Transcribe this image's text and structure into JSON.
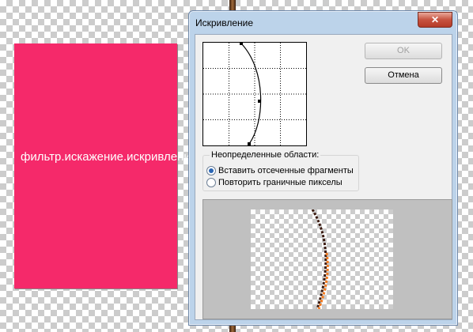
{
  "canvas": {
    "text": "фильтр.искажение.искривление.",
    "color": "#f5296a"
  },
  "dialog": {
    "title": "Искривление",
    "close_label": "✕",
    "ok_label": "OK",
    "cancel_label": "Отмена",
    "undefined_areas": {
      "title": "Неопределенные области:",
      "options": [
        {
          "label": "Вставить отсеченные фрагменты",
          "selected": true
        },
        {
          "label": "Повторить граничные пикселы",
          "selected": false
        }
      ]
    }
  }
}
